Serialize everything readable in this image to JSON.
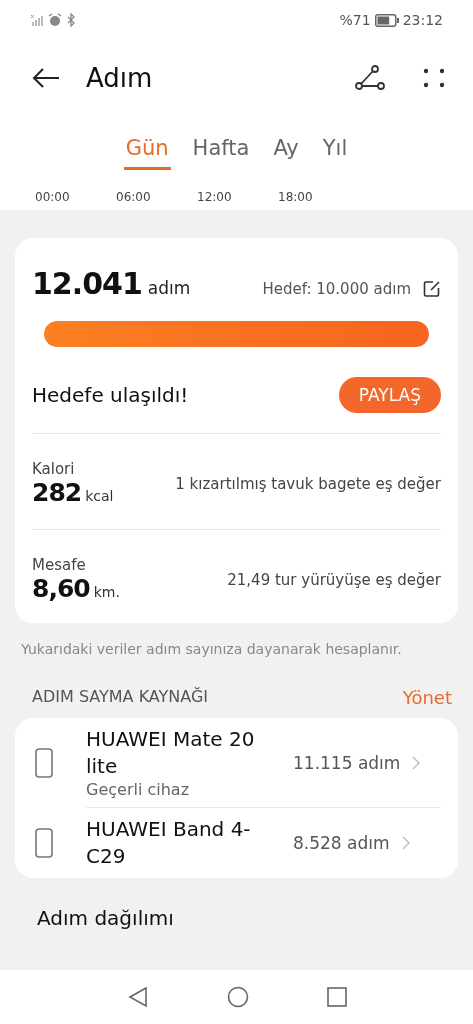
{
  "status_bar": {
    "battery_percent": "%71",
    "time": "23:12"
  },
  "header": {
    "title": "Adım"
  },
  "tabs": [
    {
      "label": "Gün",
      "selected": true
    },
    {
      "label": "Hafta",
      "selected": false
    },
    {
      "label": "Ay",
      "selected": false
    },
    {
      "label": "Yıl",
      "selected": false
    }
  ],
  "time_axis": [
    "00:00",
    "06:00",
    "12:00",
    "18:00"
  ],
  "summary": {
    "steps": "12.041",
    "steps_unit": "adım",
    "goal": "Hedef: 10.000 adım",
    "level": 1,
    "message": "Hedefe ulaşıldı!",
    "share_button": "PAYLAŞ",
    "stats": [
      {
        "label": "Kalori",
        "value": "282",
        "unit": "kcal",
        "equivalent": "1 kızartılmış tavuk bagete eş değer"
      },
      {
        "label": "Mesafe",
        "value": "8,60",
        "unit": "km.",
        "equivalent": "21,49 tur yürüyüşe eş değer"
      }
    ]
  },
  "note": "Yukarıdaki veriler adım sayınıza dayanarak hesaplanır.",
  "sources": {
    "title": "ADIM SAYMA KAYNAĞI",
    "action": "Yönet",
    "items": [
      {
        "name": "HUAWEI Mate 20 lite",
        "subtitle": "Geçerli cihaz",
        "steps": "11.115 adım"
      },
      {
        "name": "HUAWEI Band 4-C29",
        "steps": "8.528 adım"
      }
    ]
  },
  "distribution_title": "Adım dağılımı"
}
